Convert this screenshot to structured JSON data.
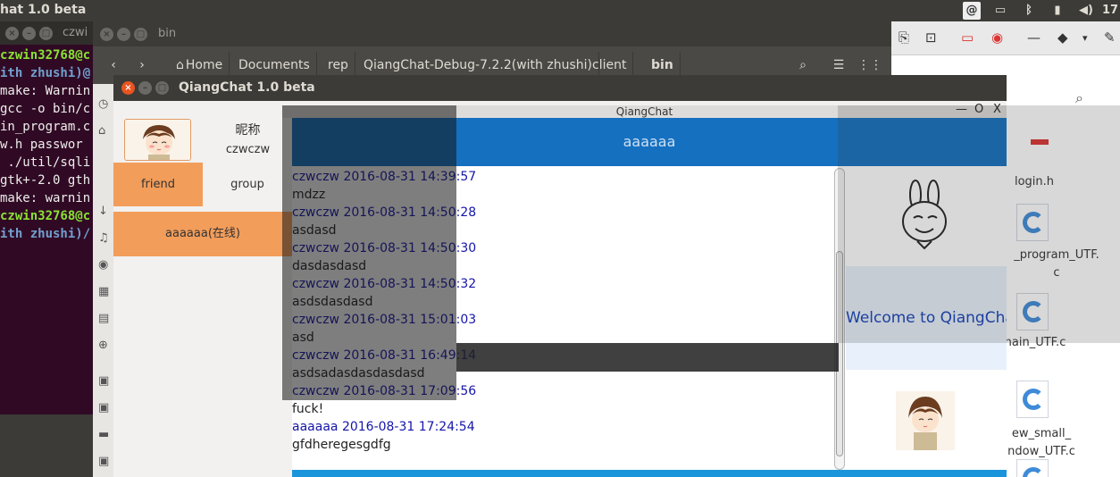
{
  "topbar": {
    "title": "hat 1.0 beta",
    "clock": "17"
  },
  "terminal": {
    "title": "czwi",
    "lines": [
      {
        "t": "czwin32768@c",
        "k": "g"
      },
      {
        "t": "ith zhushi)@",
        "k": "b"
      },
      {
        "t": "make: Warnin",
        "k": ""
      },
      {
        "t": "gcc -o bin/c",
        "k": ""
      },
      {
        "t": "in_program.c",
        "k": ""
      },
      {
        "t": "w.h passwor",
        "k": ""
      },
      {
        "t": " ./util/sqli",
        "k": ""
      },
      {
        "t": "gtk+-2.0 gth",
        "k": ""
      },
      {
        "t": "make: warnin",
        "k": ""
      },
      {
        "t": "czwin32768@c",
        "k": "g"
      },
      {
        "t": "ith zhushi)/",
        "k": "b"
      }
    ]
  },
  "filemanager": {
    "title": "bin",
    "breadcrumbs": [
      {
        "label": "Home",
        "active": false
      },
      {
        "label": "Documents",
        "active": false
      },
      {
        "label": "rep",
        "active": false
      },
      {
        "label": "QiangChat-Debug-7.2.2(with zhushi)",
        "active": false
      },
      {
        "label": "client",
        "active": false
      },
      {
        "label": "bin",
        "active": true
      }
    ]
  },
  "drawing": {
    "files": [
      {
        "name": "login.h"
      },
      {
        "name": "_program_UTF.\nc"
      },
      {
        "name": "nain_UTF.c"
      },
      {
        "name": "ew_small_\nndow_UTF.c"
      }
    ]
  },
  "qiangchat": {
    "window_title": "QiangChat 1.0 beta",
    "nickname_label": "昵称",
    "nickname_value": "czwczw",
    "tabs": {
      "friend": "friend",
      "group": "group"
    },
    "friend_list": [
      {
        "label": "aaaaaa(在线)"
      }
    ]
  },
  "chat": {
    "window_title": "QiangChat",
    "controls": {
      "min": "—",
      "max": "O",
      "close": "X"
    },
    "peer_name": "aaaaaa",
    "welcome": "Welcome to QiangChat",
    "messages": [
      {
        "sender": "czwczw",
        "time": "2016-08-31 14:39:57",
        "text": "mdzz"
      },
      {
        "sender": "czwczw",
        "time": "2016-08-31 14:50:28",
        "text": "asdasd"
      },
      {
        "sender": "czwczw",
        "time": "2016-08-31 14:50:30",
        "text": "dasdasdasd"
      },
      {
        "sender": "czwczw",
        "time": "2016-08-31 14:50:32",
        "text": "asdsdasdasd"
      },
      {
        "sender": "czwczw",
        "time": "2016-08-31 15:01:03",
        "text": "asd"
      },
      {
        "sender": "czwczw",
        "time": "2016-08-31 16:49:14",
        "text": "asdsadasdasdasdasd"
      },
      {
        "sender": "czwczw",
        "time": "2016-08-31 17:09:56",
        "text": "fuck!"
      },
      {
        "sender": "aaaaaa",
        "time": "2016-08-31 17:24:54",
        "text": "gfdheregesgdfg"
      }
    ]
  },
  "colors": {
    "ubuntu_orange": "#e95420",
    "friend_tab": "#f29d5a",
    "chat_header": "#1570c0",
    "sender_blue": "#1515aa"
  }
}
